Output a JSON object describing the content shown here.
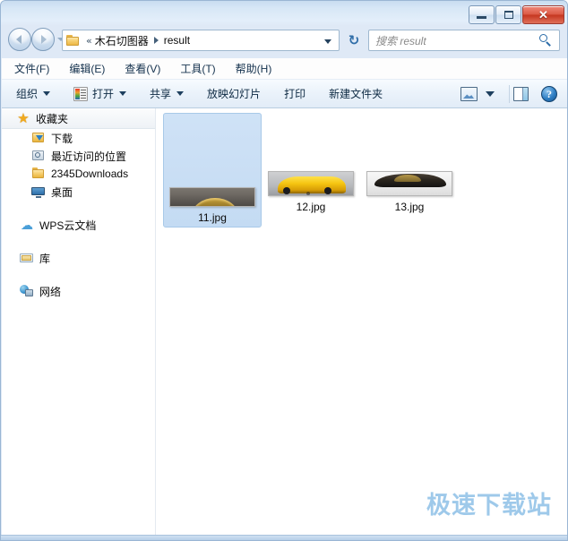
{
  "window": {
    "controls": {
      "minimize_label": "—",
      "maximize_label": "",
      "close_label": "✕"
    }
  },
  "address_bar": {
    "folder_icon": "folder-icon",
    "overflow_chevron": "«",
    "crumbs": [
      {
        "label": "木石切图器"
      },
      {
        "label": "result"
      }
    ],
    "dropdown_icon": "chevron-down-icon",
    "refresh_icon": "refresh-icon",
    "refresh_glyph": "↻"
  },
  "search": {
    "placeholder": "搜索 result",
    "icon": "search-icon"
  },
  "menu": {
    "items": [
      {
        "label": "文件(F)"
      },
      {
        "label": "编辑(E)"
      },
      {
        "label": "查看(V)"
      },
      {
        "label": "工具(T)"
      },
      {
        "label": "帮助(H)"
      }
    ]
  },
  "toolbar": {
    "organize_label": "组织",
    "open_label": "打开",
    "share_label": "共享",
    "slideshow_label": "放映幻灯片",
    "print_label": "打印",
    "new_folder_label": "新建文件夹",
    "view_icon": "view-mode-icon",
    "preview_icon": "preview-pane-icon",
    "help_icon": "help-icon",
    "help_glyph": "?"
  },
  "sidebar": {
    "groups": [
      {
        "header": {
          "label": "收藏夹",
          "icon": "star-icon"
        },
        "items": [
          {
            "label": "下载",
            "icon": "downloads-folder-icon"
          },
          {
            "label": "最近访问的位置",
            "icon": "recent-places-icon"
          },
          {
            "label": "2345Downloads",
            "icon": "folder-icon"
          },
          {
            "label": "桌面",
            "icon": "desktop-icon"
          }
        ]
      },
      {
        "header": {
          "label": "WPS云文档",
          "icon": "cloud-icon"
        },
        "items": []
      },
      {
        "header": {
          "label": "库",
          "icon": "library-icon"
        },
        "items": []
      },
      {
        "header": {
          "label": "网络",
          "icon": "network-icon"
        },
        "items": []
      }
    ]
  },
  "files": [
    {
      "name": "11.jpg",
      "selected": true,
      "thumb_class": "t11"
    },
    {
      "name": "12.jpg",
      "selected": false,
      "thumb_class": "t12"
    },
    {
      "name": "13.jpg",
      "selected": false,
      "thumb_class": "t13"
    }
  ],
  "watermark": {
    "text": "极速下载站",
    "color": "#9ec9ea"
  }
}
